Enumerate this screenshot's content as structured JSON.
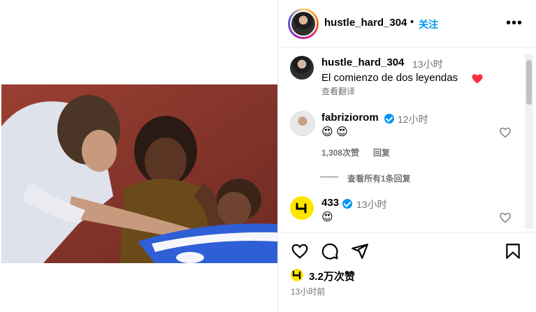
{
  "header": {
    "username": "hustle_hard_304",
    "separator": "•",
    "follow_label": "关注",
    "more_icon": "more-horizontal-icon"
  },
  "caption": {
    "username": "hustle_hard_304",
    "time": "13小时",
    "text": "El comienzo de dos leyendas",
    "emoji": "❤️",
    "translate_label": "查看翻译"
  },
  "comments": [
    {
      "username": "fabriziorom",
      "verified": true,
      "time": "12小时",
      "text": "😍 😍",
      "likes": "1,308次赞",
      "reply_label": "回复",
      "view_replies_label": "查看所有1条回复"
    },
    {
      "username": "433",
      "verified": true,
      "time": "13小时",
      "text": "😍"
    }
  ],
  "actions": {
    "like_icon": "heart-icon",
    "comment_icon": "comment-icon",
    "share_icon": "share-icon",
    "save_icon": "bookmark-icon"
  },
  "likes": {
    "text": "3.2万次赞"
  },
  "post_time": "13小时前",
  "colors": {
    "link_blue": "#0095f6",
    "muted": "#737373",
    "heart_red": "#ff3040",
    "brand_433": "#ffe600"
  }
}
